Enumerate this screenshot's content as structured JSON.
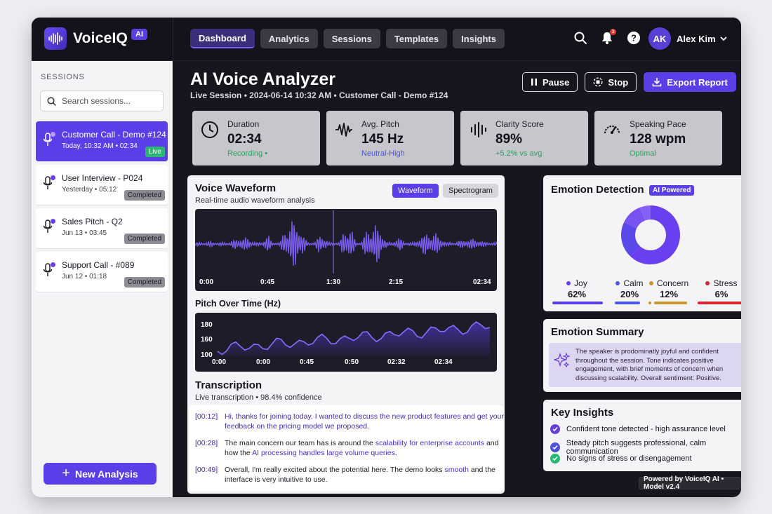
{
  "brand": {
    "name": "VoiceIQ",
    "badge": "AI"
  },
  "nav": {
    "tabs": [
      "Dashboard",
      "Analytics",
      "Sessions",
      "Templates",
      "Insights"
    ],
    "active": "Dashboard"
  },
  "topbar": {
    "icons": [
      "search-icon",
      "bell-icon",
      "help-icon"
    ],
    "notification_count": "3"
  },
  "user": {
    "initials": "AK",
    "name": "Alex Kim"
  },
  "sidebar": {
    "label": "SESSIONS",
    "search_placeholder": "Search sessions...",
    "sessions": [
      {
        "title": "Customer Call - Demo #124",
        "meta": "Today, 10:32 AM • 02:34",
        "status": "Live"
      },
      {
        "title": "User Interview - P024",
        "meta": "Yesterday • 05:12",
        "status": "Completed"
      },
      {
        "title": "Sales Pitch - Q2",
        "meta": "Jun 13 • 03:45",
        "status": "Completed"
      },
      {
        "title": "Support Call - #089",
        "meta": "Jun 12 • 01:18",
        "status": "Completed"
      }
    ],
    "new_button": "New Analysis"
  },
  "header": {
    "title": "AI Voice Analyzer",
    "subtitle": "Live Session • 2024-06-14 10:32 AM • Customer Call - Demo #124",
    "pause": "Pause",
    "stop": "Stop",
    "export": "Export Report"
  },
  "stats": [
    {
      "label": "Duration",
      "value": "02:34",
      "sub": "Recording •",
      "sub_color": "#2e9e5e",
      "icon": "clock-icon"
    },
    {
      "label": "Avg. Pitch",
      "value": "145 Hz",
      "sub": "Neutral-High",
      "sub_color": "#4b4ee0",
      "icon": "pulse-icon"
    },
    {
      "label": "Clarity Score",
      "value": "89%",
      "sub": "+5.2% vs avg",
      "sub_color": "#2e9e5e",
      "icon": "waveform-icon"
    },
    {
      "label": "Speaking Pace",
      "value": "128 wpm",
      "sub": "Optimal",
      "sub_color": "#2e9e5e",
      "icon": "gauge-icon"
    }
  ],
  "waveform": {
    "title": "Voice Waveform",
    "subtitle": "Real-time audio waveform analysis",
    "tab_waveform": "Waveform",
    "tab_spectrogram": "Spectrogram",
    "ticks": [
      "0:00",
      "0:45",
      "1:30",
      "2:15",
      "02:34"
    ]
  },
  "pitch": {
    "title": "Pitch Over Time (Hz)",
    "y_ticks": [
      "180",
      "160",
      "100"
    ],
    "x_ticks": [
      "0:00",
      "0:00",
      "0:45",
      "0:50",
      "02:32",
      "02:34"
    ]
  },
  "transcription": {
    "title": "Transcription",
    "subtitle": "Live transcription • 98.4% confidence",
    "lines": [
      {
        "time": "[00:12]",
        "l1": "Hi, thanks for joining today. I wanted to discuss the new product features and get your",
        "l2": "feedback on the pricing model we proposed."
      },
      {
        "time": "[00:28]",
        "l1a": "The main concern our team has is around the ",
        "l1b": "scalability for enterprise accounts",
        "l1c": " and",
        "l2a": "how the ",
        "l2b": "AI processing handles large volume queries",
        "l2c": "."
      },
      {
        "time": "[00:49]",
        "l1a": "Overall, I'm really excited about the potential here. The demo looks ",
        "l1b": "smooth",
        "l1c": " and the",
        "l2": "interface is very intuitive to use."
      }
    ]
  },
  "emotion": {
    "title": "Emotion Detection",
    "badge": "AI Powered",
    "items": [
      {
        "name": "Joy",
        "value": "62%",
        "color": "#6a3ff0"
      },
      {
        "name": "Calm",
        "value": "20%",
        "color": "#4b57e8"
      },
      {
        "name": "Concern",
        "value": "12%",
        "color": "#c9962f"
      },
      {
        "name": "Stress",
        "value": "6%",
        "color": "#d7262e"
      }
    ]
  },
  "summary": {
    "title": "Emotion Summary",
    "text": "The speaker is prodominatly joyful and confident throughout the session. Tone indicates positive engagement, with brief moments of concern when discussing scalability. Overall sentiment: Positive."
  },
  "insights": {
    "title": "Key Insights",
    "items": [
      {
        "text": "Confident tone detected - high assurance level",
        "color": "#6a3fd8"
      },
      {
        "text": "Steady pitch suggests professional, calm communication",
        "color": "#4b50d8"
      },
      {
        "text": "No signs of stress or disengagement",
        "color": "#27b874"
      }
    ]
  },
  "footer": "Powered by VoiceIQ AI • Model v2.4"
}
